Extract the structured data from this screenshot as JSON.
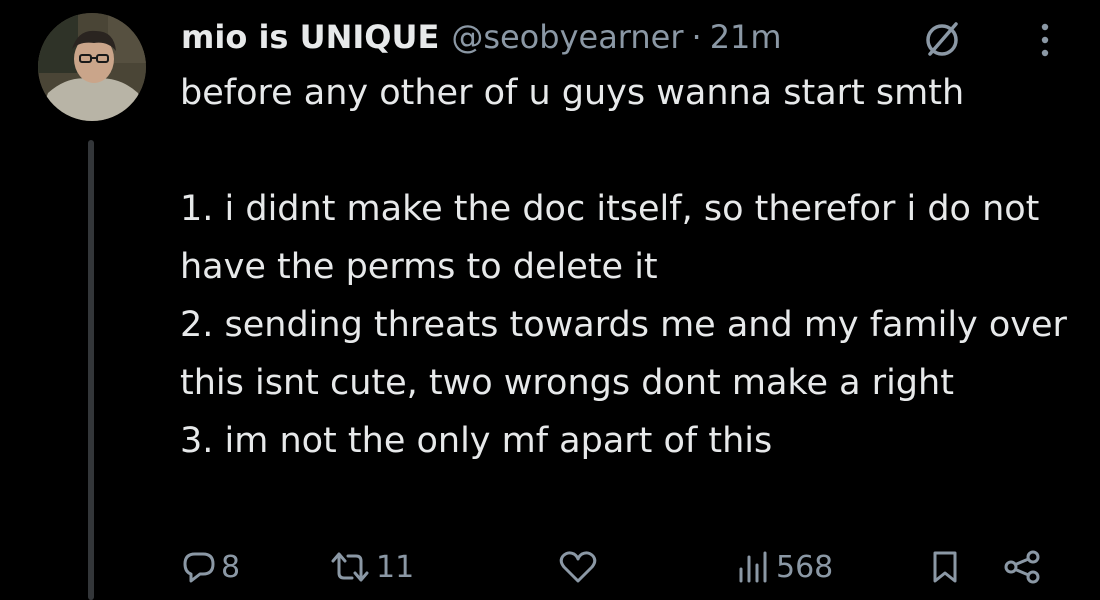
{
  "author": {
    "display_name": "mio is UNIQUE",
    "handle": "@seobyearner",
    "separator": "·",
    "time": "21m"
  },
  "tweet": {
    "intro": "before any other of u guys wanna start smth",
    "points": [
      "1. i didnt make the doc itself, so therefor i do not have the perms to delete it",
      "2. sending threats towards me and my family over this isnt cute, two wrongs dont make a right",
      "3. im not the only mf apart of this"
    ]
  },
  "actions": {
    "replies": "8",
    "retweets": "11",
    "views": "568"
  },
  "colors": {
    "background": "#000000",
    "text": "#e7e9ea",
    "secondary": "#8b98a5",
    "thread_line": "#333639"
  },
  "icons": [
    "avatar",
    "ghost-icon",
    "more-icon",
    "reply-icon",
    "retweet-icon",
    "like-icon",
    "views-icon",
    "bookmark-icon",
    "share-icon"
  ]
}
